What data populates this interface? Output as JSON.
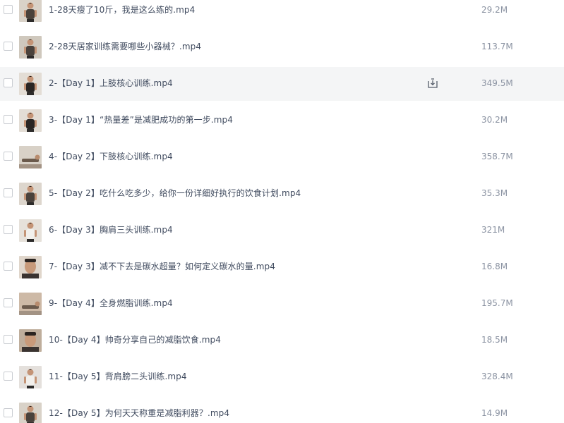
{
  "files": [
    {
      "name": "1-28天瘦了10斤，我是这么练的.mp4",
      "size": "29.2M",
      "thumb": "thumb-man-standing"
    },
    {
      "name": "2-28天居家训练需要哪些小器械？.mp4",
      "size": "113.7M",
      "thumb": "thumb-man-room"
    },
    {
      "name": "2-【Day 1】上肢核心训练.mp4",
      "size": "349.5M",
      "thumb": "thumb-man-dark-tank"
    },
    {
      "name": "3-【Day 1】“热量差”是减肥成功的第一步.mp4",
      "size": "30.2M",
      "thumb": "thumb-man-dark-tank"
    },
    {
      "name": "4-【Day 2】下肢核心训练.mp4",
      "size": "358.7M",
      "thumb": "thumb-plank"
    },
    {
      "name": "5-【Day 2】吃什么吃多少，给你一份详细好执行的饮食计划.mp4",
      "size": "35.3M",
      "thumb": "thumb-man-talking"
    },
    {
      "name": "6-【Day 3】胸肩三头训练.mp4",
      "size": "321M",
      "thumb": "thumb-man-white-shirt"
    },
    {
      "name": "7-【Day 3】减不下去是碳水超量？如何定义碳水的量.mp4",
      "size": "16.8M",
      "thumb": "thumb-man-hand"
    },
    {
      "name": "9-【Day 4】全身燃脂训练.mp4",
      "size": "195.7M",
      "thumb": "thumb-floor-exercise"
    },
    {
      "name": "10-【Day 4】帅奇分享自己的减脂饮食.mp4",
      "size": "18.5M",
      "thumb": "thumb-man-closeup"
    },
    {
      "name": "11-【Day 5】背肩膀二头训练.mp4",
      "size": "328.4M",
      "thumb": "thumb-man-room-light"
    },
    {
      "name": "12-【Day 5】为何天天称重是减脂利器？.mp4",
      "size": "14.9M",
      "thumb": "thumb-man-standing"
    }
  ],
  "highlighted_index": 2,
  "download_icon": "download-icon",
  "colors": {
    "text": "#3f4a5e",
    "size_text": "#8b93a2",
    "row_highlight": "#f4f5f6",
    "checkbox_border": "#c9ccd1"
  }
}
